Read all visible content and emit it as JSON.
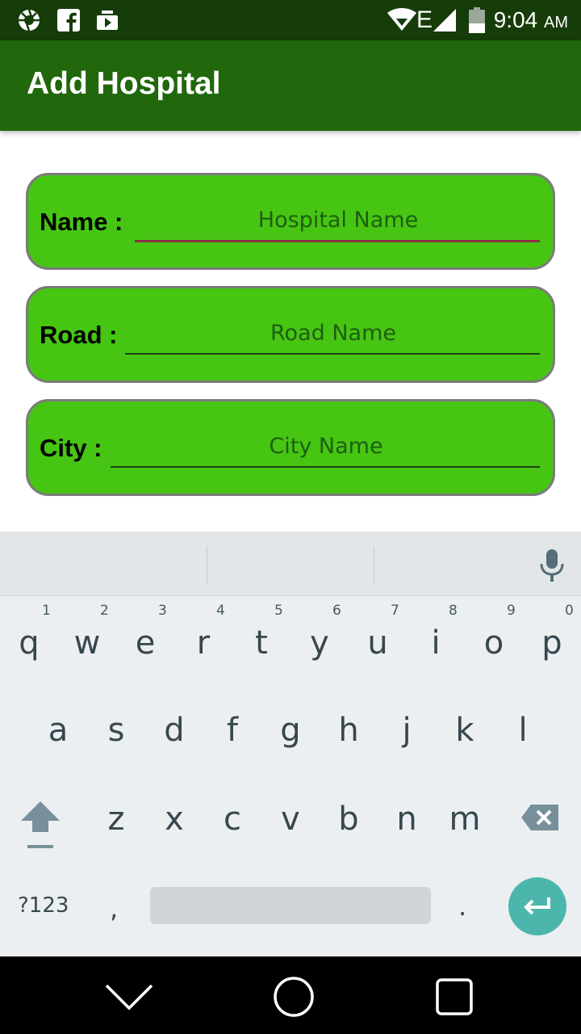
{
  "status_bar": {
    "time": "9:04",
    "ampm": "AM",
    "network_type": "E",
    "icons": [
      "aperture-icon",
      "facebook-icon",
      "media-icon",
      "wifi-icon",
      "signal-icon",
      "battery-icon"
    ]
  },
  "app_bar": {
    "title": "Add Hospital"
  },
  "form": {
    "name": {
      "label": "Name :",
      "placeholder": "Hospital Name"
    },
    "road": {
      "label": "Road :",
      "placeholder": "Road Name"
    },
    "city": {
      "label": "City :",
      "placeholder": "City Name"
    }
  },
  "keyboard": {
    "row1": [
      "q",
      "w",
      "e",
      "r",
      "t",
      "y",
      "u",
      "i",
      "o",
      "p"
    ],
    "row1_hints": [
      "1",
      "2",
      "3",
      "4",
      "5",
      "6",
      "7",
      "8",
      "9",
      "0"
    ],
    "row2": [
      "a",
      "s",
      "d",
      "f",
      "g",
      "h",
      "j",
      "k",
      "l"
    ],
    "row3": [
      "z",
      "x",
      "c",
      "v",
      "b",
      "n",
      "m"
    ],
    "symbols_label": "?123",
    "comma": ",",
    "period": "."
  },
  "colors": {
    "status_bar": "#163c0a",
    "app_bar": "#21670b",
    "card_fill": "#46c613",
    "card_border": "#7b7b7b",
    "focused_underline": "#8c2f4a",
    "enter_key": "#4db6ac"
  }
}
